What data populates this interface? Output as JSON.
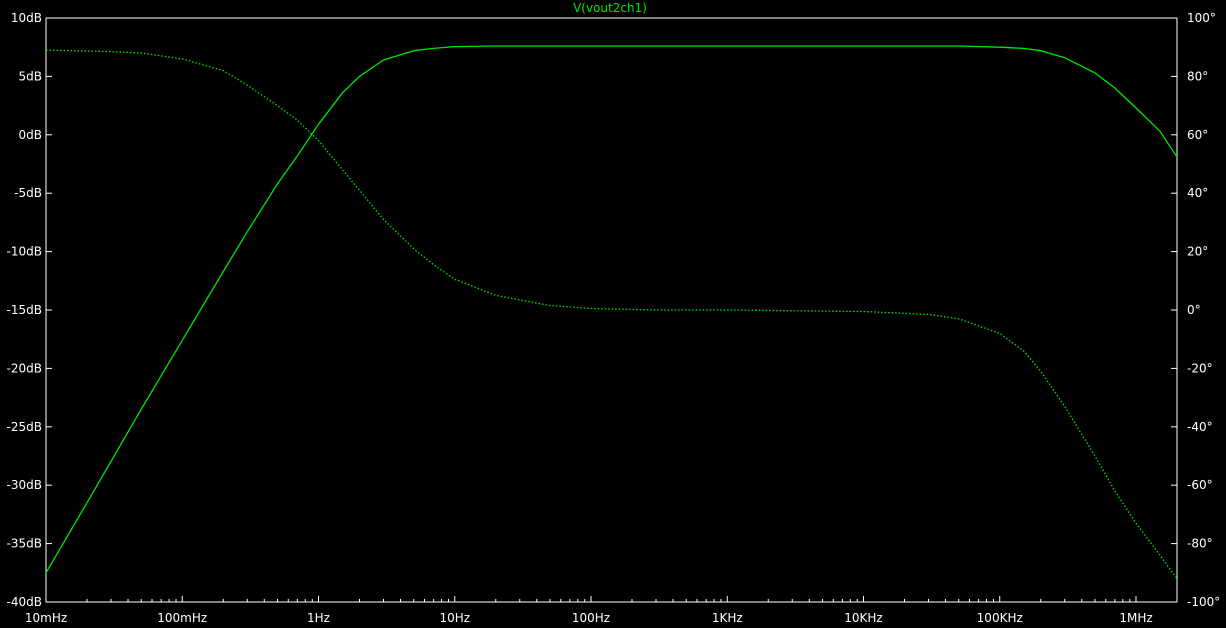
{
  "window": {
    "trace_title": "V(vout2ch1)"
  },
  "chart_data": {
    "type": "line",
    "title": "V(vout2ch1)",
    "xscale": "log",
    "xlim": [
      0.01,
      2000000
    ],
    "ylim_left": [
      -40,
      10
    ],
    "ylim_right": [
      -100,
      100
    ],
    "grid": false,
    "trace_color": "#00e600",
    "x_ticks": [
      {
        "value": 0.01,
        "label": "10mHz"
      },
      {
        "value": 0.1,
        "label": "100mHz"
      },
      {
        "value": 1,
        "label": "1Hz"
      },
      {
        "value": 10,
        "label": "10Hz"
      },
      {
        "value": 100,
        "label": "100Hz"
      },
      {
        "value": 1000,
        "label": "1KHz"
      },
      {
        "value": 10000,
        "label": "10KHz"
      },
      {
        "value": 100000,
        "label": "100KHz"
      },
      {
        "value": 1000000,
        "label": "1MHz"
      }
    ],
    "y_left_ticks": [
      {
        "value": 10,
        "label": "10dB"
      },
      {
        "value": 5,
        "label": "5dB"
      },
      {
        "value": 0,
        "label": "0dB"
      },
      {
        "value": -5,
        "label": "-5dB"
      },
      {
        "value": -10,
        "label": "-10dB"
      },
      {
        "value": -15,
        "label": "-15dB"
      },
      {
        "value": -20,
        "label": "-20dB"
      },
      {
        "value": -25,
        "label": "-25dB"
      },
      {
        "value": -30,
        "label": "-30dB"
      },
      {
        "value": -35,
        "label": "-35dB"
      },
      {
        "value": -40,
        "label": "-40dB"
      }
    ],
    "y_right_ticks": [
      {
        "value": 100,
        "label": "100°"
      },
      {
        "value": 80,
        "label": "80°"
      },
      {
        "value": 60,
        "label": "60°"
      },
      {
        "value": 40,
        "label": "40°"
      },
      {
        "value": 20,
        "label": "20°"
      },
      {
        "value": 0,
        "label": "0°"
      },
      {
        "value": -20,
        "label": "-20°"
      },
      {
        "value": -40,
        "label": "-40°"
      },
      {
        "value": -60,
        "label": "-60°"
      },
      {
        "value": -80,
        "label": "-80°"
      },
      {
        "value": -100,
        "label": "-100°"
      }
    ],
    "series": [
      {
        "name": "V(vout2ch1)",
        "axis": "left",
        "style": "solid",
        "x": [
          0.01,
          0.02,
          0.05,
          0.1,
          0.2,
          0.3,
          0.5,
          0.7,
          1,
          1.5,
          2,
          3,
          5,
          7,
          10,
          20,
          50,
          100,
          1000,
          10000,
          50000,
          100000,
          150000,
          200000,
          300000,
          500000,
          700000,
          1000000,
          1500000,
          2000000
        ],
        "values": [
          -37.5,
          -31.5,
          -23.5,
          -17.6,
          -11.7,
          -8.3,
          -4.2,
          -1.8,
          0.9,
          3.6,
          5.0,
          6.4,
          7.2,
          7.4,
          7.55,
          7.6,
          7.6,
          7.6,
          7.6,
          7.6,
          7.6,
          7.5,
          7.4,
          7.2,
          6.6,
          5.3,
          4.0,
          2.3,
          0.3,
          -1.9
        ]
      },
      {
        "name": "phase",
        "axis": "right",
        "style": "dotted",
        "x": [
          0.01,
          0.03,
          0.05,
          0.1,
          0.2,
          0.3,
          0.5,
          0.7,
          1,
          1.5,
          2,
          3,
          5,
          7,
          10,
          20,
          50,
          100,
          300,
          1000,
          10000,
          30000,
          50000,
          100000,
          150000,
          200000,
          300000,
          500000,
          700000,
          1000000,
          1500000,
          2000000
        ],
        "values": [
          89,
          88.5,
          88,
          86,
          82,
          77,
          70,
          65,
          58,
          48,
          41,
          31,
          21,
          15.5,
          10.5,
          5,
          1.5,
          0.5,
          0,
          0,
          -0.5,
          -1.5,
          -3,
          -8,
          -14,
          -21,
          -33,
          -50,
          -62,
          -73,
          -84,
          -92
        ]
      }
    ]
  }
}
